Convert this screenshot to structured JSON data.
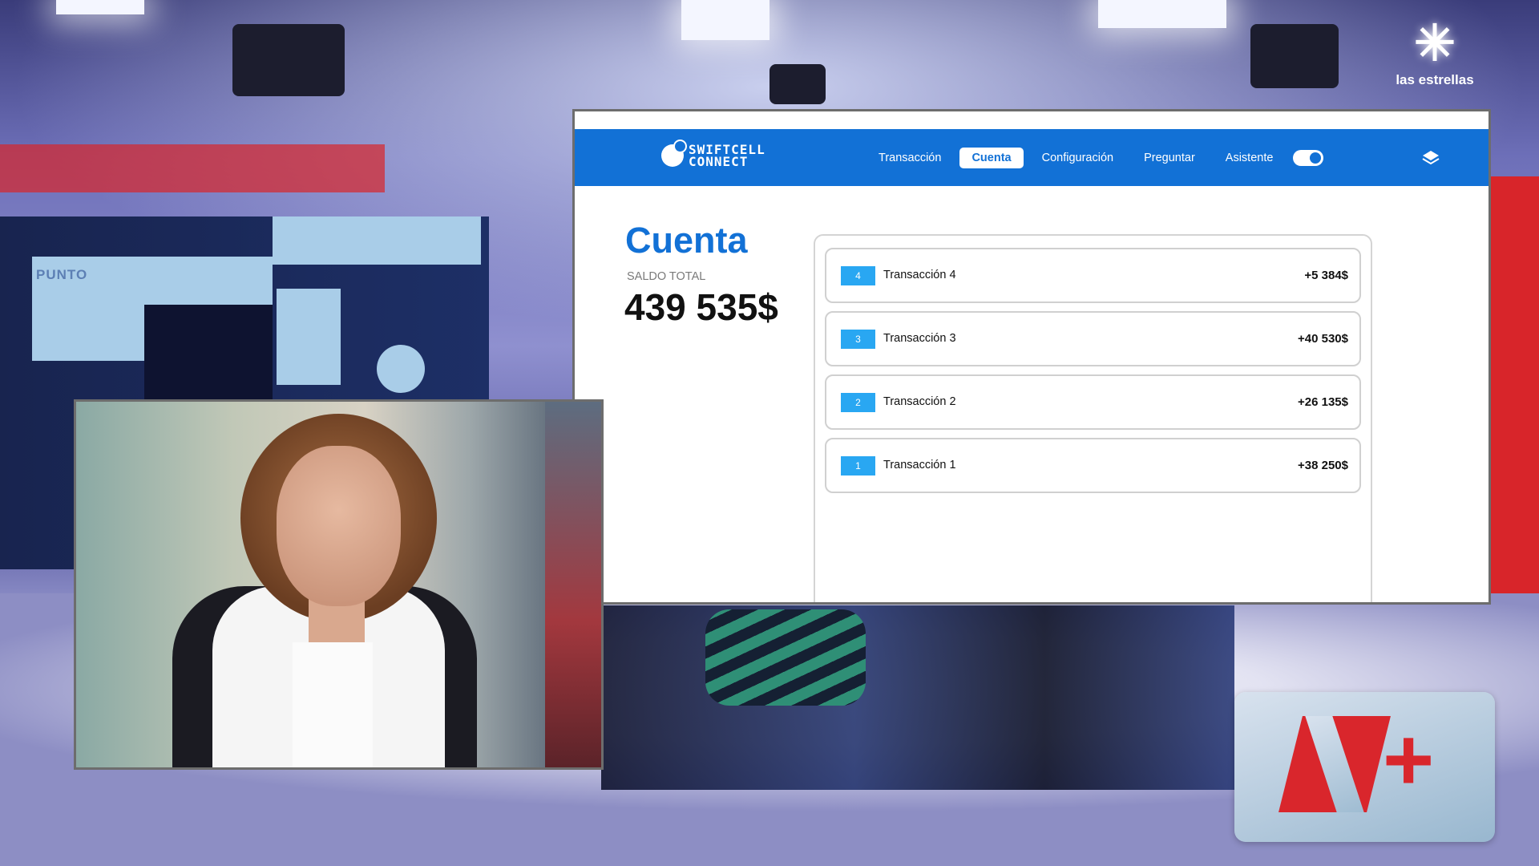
{
  "overlay": {
    "channel_logo": "las estrellas",
    "studio_sign": "PUNTO",
    "news_logo": "N+"
  },
  "app": {
    "brand": {
      "line1": "SWIFTCELL",
      "line2": "CONNECT"
    },
    "nav": {
      "items": [
        {
          "label": "Transacción",
          "active": false
        },
        {
          "label": "Cuenta",
          "active": true
        },
        {
          "label": "Configuración",
          "active": false
        },
        {
          "label": "Preguntar",
          "active": false
        },
        {
          "label": "Asistente",
          "active": false
        }
      ],
      "toggle_on": true
    },
    "page_title": "Cuenta",
    "balance": {
      "label": "SALDO TOTAL",
      "value": "439 535$"
    },
    "transactions": [
      {
        "id": "4",
        "name": "Transacción 4",
        "amount": "+5 384$"
      },
      {
        "id": "3",
        "name": "Transacción 3",
        "amount": "+40 530$"
      },
      {
        "id": "2",
        "name": "Transacción 2",
        "amount": "+26 135$"
      },
      {
        "id": "1",
        "name": "Transacción 1",
        "amount": "+38 250$"
      }
    ]
  },
  "colors": {
    "brand_blue": "#1271d6",
    "badge_blue": "#29a7f2",
    "news_red": "#d9262c"
  }
}
